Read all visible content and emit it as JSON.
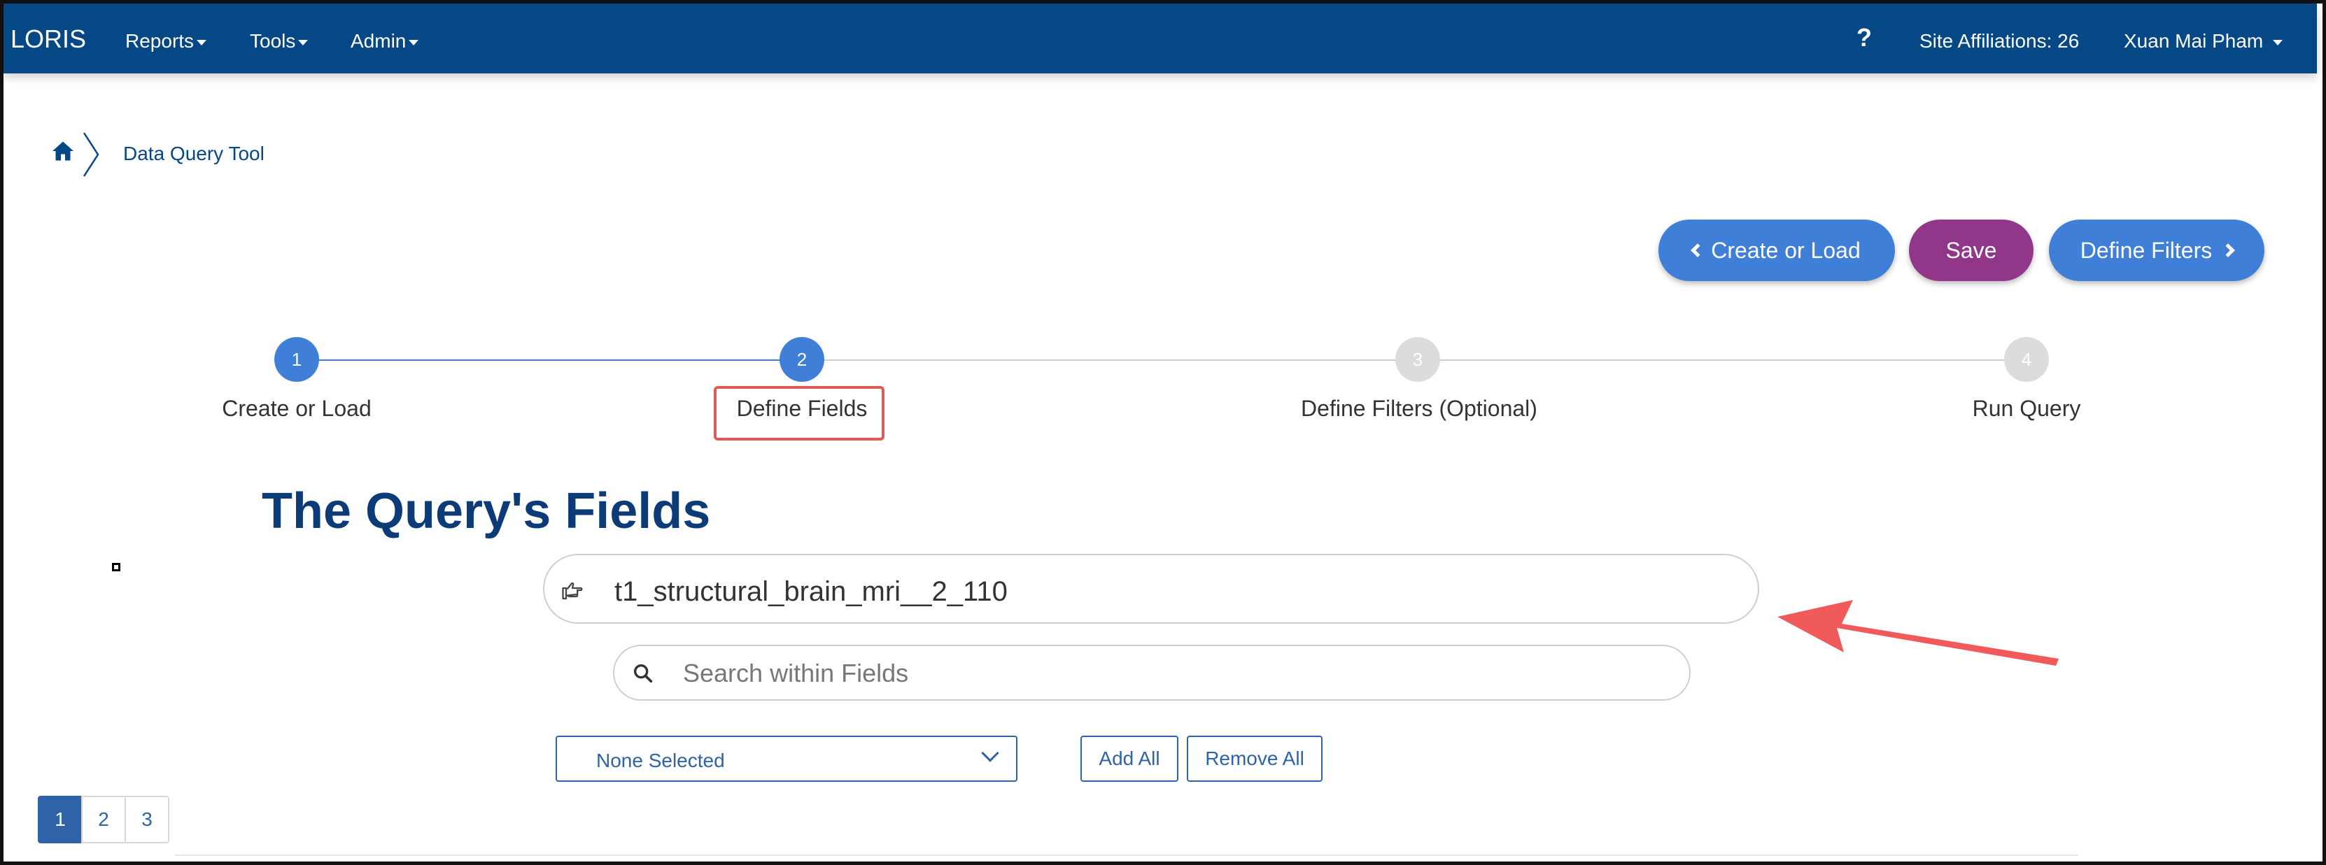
{
  "navbar": {
    "brand": "LORIS",
    "menus": [
      "Reports",
      "Tools",
      "Admin"
    ],
    "help": "?",
    "site_affiliations": "Site Affiliations: 26",
    "user": "Xuan Mai Pham"
  },
  "breadcrumb": {
    "current": "Data Query Tool"
  },
  "actions": {
    "create_or_load": "Create or Load",
    "save": "Save",
    "define_filters": "Define Filters"
  },
  "stepper": {
    "steps": [
      {
        "number": "1",
        "label": "Create or Load",
        "state": "complete"
      },
      {
        "number": "2",
        "label": "Define Fields",
        "state": "current"
      },
      {
        "number": "3",
        "label": "Define Filters (Optional)",
        "state": "upcoming"
      },
      {
        "number": "4",
        "label": "Run Query",
        "state": "upcoming"
      }
    ]
  },
  "section": {
    "title": "The Query's Fields"
  },
  "field_chip": {
    "value": "t1_structural_brain_mri__2_110"
  },
  "search": {
    "placeholder": "Search within Fields"
  },
  "selector": {
    "value": "None Selected",
    "add_all": "Add All",
    "remove_all": "Remove All"
  },
  "pagination": {
    "pages": [
      "1",
      "2",
      "3"
    ],
    "active": "1"
  },
  "colors": {
    "navbar": "#064785",
    "primary": "#3f7fd8",
    "save": "#92368a",
    "title": "#0c3c78",
    "annotation": "#e05a5a"
  },
  "icons": {
    "home": "home-icon",
    "field": "hand-pointing-icon",
    "search": "search-icon"
  }
}
